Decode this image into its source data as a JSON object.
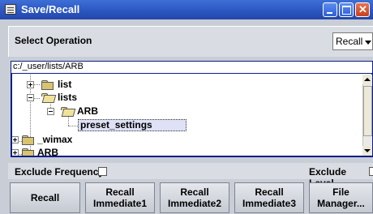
{
  "window": {
    "title": "Save/Recall"
  },
  "select_operation": {
    "label": "Select Operation",
    "value": "Recall"
  },
  "path": "c:/_user/lists/ARB",
  "tree": {
    "nodes": [
      {
        "label": "list"
      },
      {
        "label": "lists"
      },
      {
        "label": "ARB"
      },
      {
        "label": "preset_settings"
      },
      {
        "label": "_wimax"
      },
      {
        "label": "ARB"
      }
    ]
  },
  "exclude": {
    "frequency_label": "Exclude Frequency",
    "level_label": "Exclude Level"
  },
  "buttons": {
    "recall": "Recall",
    "recall_immediate1": "Recall\nImmediate1",
    "recall_immediate2": "Recall\nImmediate2",
    "recall_immediate3": "Recall\nImmediate3",
    "file_manager": "File\nManager..."
  }
}
